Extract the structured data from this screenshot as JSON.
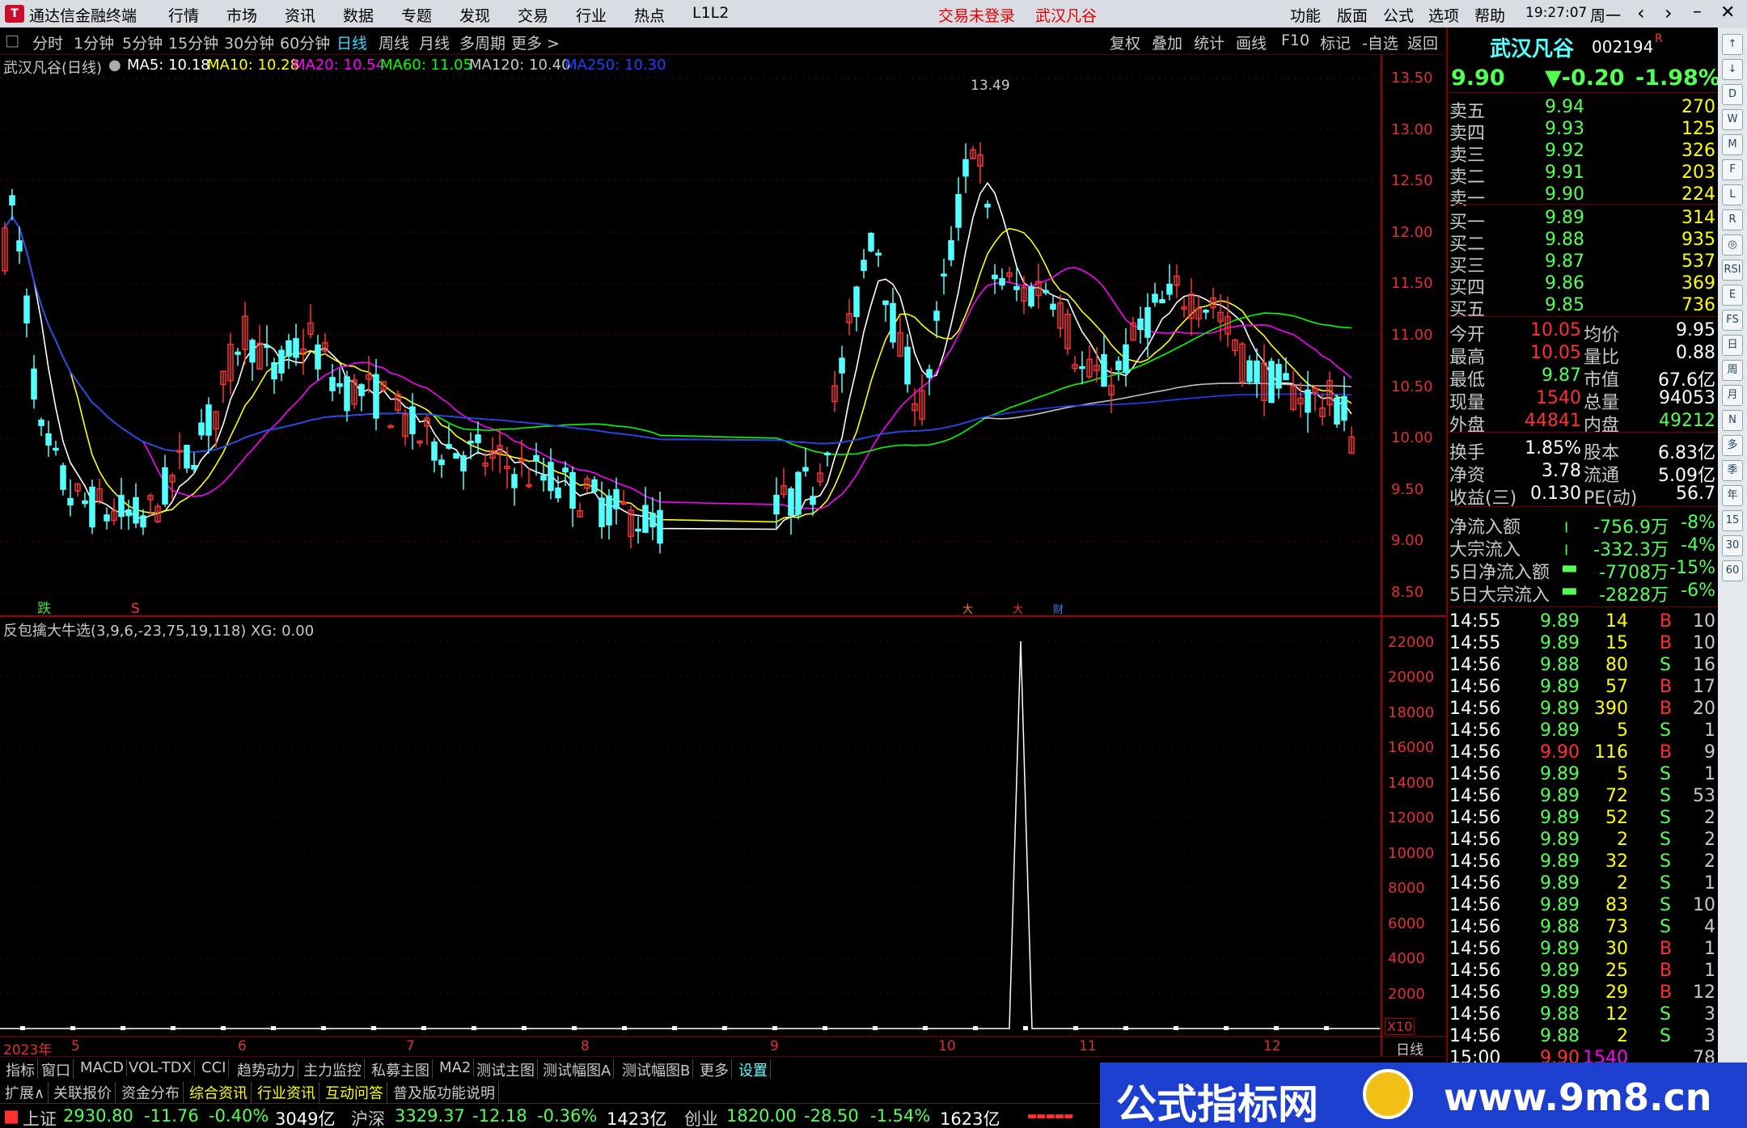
{
  "titlebar": {
    "app_title": "通达信金融终端",
    "menus": [
      "行情",
      "市场",
      "资讯",
      "数据",
      "专题",
      "发现",
      "交易",
      "行业",
      "热点",
      "L1L2"
    ],
    "status": "交易未登录",
    "stock": "武汉凡谷",
    "right_menus": [
      "功能",
      "版面",
      "公式",
      "选项",
      "帮助"
    ],
    "time": "19:27:07",
    "weekday": "周一"
  },
  "periods": {
    "items": [
      "分时",
      "1分钟",
      "5分钟",
      "15分钟",
      "30分钟",
      "60分钟",
      "日线",
      "周线",
      "月线",
      "多周期",
      "更多 >"
    ],
    "active": "日线",
    "right_items": [
      "复权",
      "叠加",
      "统计",
      "画线",
      "F10",
      "标记",
      "-自选",
      "返回"
    ]
  },
  "legend": {
    "name": "武汉凡谷(日线)",
    "ma5": "MA5: 10.18",
    "ma10": "MA10: 10.28",
    "ma20": "MA20: 10.54",
    "ma60": "MA60: 11.05",
    "ma120": "MA120: 10.40",
    "ma250": "MA250: 10.30"
  },
  "main_axis": {
    "labels": [
      "13.50",
      "13.00",
      "12.50",
      "12.00",
      "11.50",
      "11.00",
      "10.50",
      "10.00",
      "9.50",
      "9.00",
      "8.50"
    ]
  },
  "peak_label": "13.49",
  "markers": {
    "die": "跌",
    "s": "S",
    "m1": "大",
    "m2": "大",
    "m3": "财"
  },
  "indicator": {
    "title": "反包擒大牛选(3,9,6,-23,75,19,118)  XG: 0.00",
    "axis": [
      "22000",
      "20000",
      "18000",
      "16000",
      "14000",
      "12000",
      "10000",
      "8000",
      "6000",
      "4000",
      "2000"
    ],
    "unit": "X10"
  },
  "date_axis": {
    "labels": [
      "2023年",
      "5",
      "6",
      "7",
      "8",
      "9",
      "10",
      "11",
      "12"
    ],
    "period": "日线"
  },
  "quote": {
    "name": "武汉凡谷",
    "code": "002194",
    "flag": "R",
    "price": "9.90",
    "change": "▼-0.20",
    "pct": "-1.98%",
    "asks": [
      {
        "label": "卖五",
        "price": "9.94",
        "vol": "270"
      },
      {
        "label": "卖四",
        "price": "9.93",
        "vol": "125"
      },
      {
        "label": "卖三",
        "price": "9.92",
        "vol": "326"
      },
      {
        "label": "卖二",
        "price": "9.91",
        "vol": "203"
      },
      {
        "label": "卖一",
        "price": "9.90",
        "vol": "224"
      }
    ],
    "bids": [
      {
        "label": "买一",
        "price": "9.89",
        "vol": "314"
      },
      {
        "label": "买二",
        "price": "9.88",
        "vol": "935"
      },
      {
        "label": "买三",
        "price": "9.87",
        "vol": "537"
      },
      {
        "label": "买四",
        "price": "9.86",
        "vol": "369"
      },
      {
        "label": "买五",
        "price": "9.85",
        "vol": "736"
      }
    ],
    "stats": [
      {
        "k1": "今开",
        "v1": "10.05",
        "k2": "均价",
        "v2": "9.95"
      },
      {
        "k1": "最高",
        "v1": "10.05",
        "k2": "量比",
        "v2": "0.88"
      },
      {
        "k1": "最低",
        "v1": "9.87",
        "k2": "市值",
        "v2": "67.6亿"
      },
      {
        "k1": "现量",
        "v1": "1540",
        "k2": "总量",
        "v2": "94053"
      },
      {
        "k1": "外盘",
        "v1": "44841",
        "k2": "内盘",
        "v2": "49212"
      }
    ],
    "stats2": [
      {
        "k1": "换手",
        "v1": "1.85%",
        "k2": "股本",
        "v2": "6.83亿"
      },
      {
        "k1": "净资",
        "v1": "3.78",
        "k2": "流通",
        "v2": "5.09亿"
      },
      {
        "k1": "收益(三)",
        "v1": "0.130",
        "k2": "PE(动)",
        "v2": "56.7"
      }
    ],
    "flows": [
      {
        "k": "净流入额",
        "v": "-756.9万",
        "p": "-8%"
      },
      {
        "k": "大宗流入",
        "v": "-332.3万",
        "p": "-4%"
      },
      {
        "k": "5日净流入额",
        "v": "-7708万",
        "p": "-15%"
      },
      {
        "k": "5日大宗流入",
        "v": "-2828万",
        "p": "-6%"
      }
    ]
  },
  "ticks": [
    [
      "14:55",
      "9.89",
      "14",
      "B",
      "10"
    ],
    [
      "14:55",
      "9.89",
      "15",
      "B",
      "10"
    ],
    [
      "14:56",
      "9.88",
      "80",
      "S",
      "16"
    ],
    [
      "14:56",
      "9.89",
      "57",
      "B",
      "17"
    ],
    [
      "14:56",
      "9.89",
      "390",
      "B",
      "20"
    ],
    [
      "14:56",
      "9.89",
      "5",
      "S",
      "1"
    ],
    [
      "14:56",
      "9.90",
      "116",
      "B",
      "9"
    ],
    [
      "14:56",
      "9.89",
      "5",
      "S",
      "1"
    ],
    [
      "14:56",
      "9.89",
      "72",
      "S",
      "53"
    ],
    [
      "14:56",
      "9.89",
      "52",
      "S",
      "2"
    ],
    [
      "14:56",
      "9.89",
      "2",
      "S",
      "2"
    ],
    [
      "14:56",
      "9.89",
      "32",
      "S",
      "2"
    ],
    [
      "14:56",
      "9.89",
      "2",
      "S",
      "1"
    ],
    [
      "14:56",
      "9.89",
      "83",
      "S",
      "10"
    ],
    [
      "14:56",
      "9.88",
      "73",
      "S",
      "4"
    ],
    [
      "14:56",
      "9.89",
      "30",
      "B",
      "1"
    ],
    [
      "14:56",
      "9.89",
      "25",
      "B",
      "1"
    ],
    [
      "14:56",
      "9.89",
      "29",
      "B",
      "12"
    ],
    [
      "14:56",
      "9.88",
      "12",
      "S",
      "3"
    ],
    [
      "14:56",
      "9.88",
      "2",
      "S",
      "3"
    ],
    [
      "15:00",
      "9.90",
      "1540",
      "",
      "78"
    ]
  ],
  "side_tools": [
    "↑",
    "↓",
    "D",
    "W",
    "M",
    "F",
    "L",
    "R",
    "◎",
    "RSI",
    "E",
    "FS",
    "日",
    "周",
    "月",
    "N",
    "多",
    "季",
    "年",
    "15",
    "30",
    "60"
  ],
  "bottom_tabs": [
    "指标",
    "窗口",
    "MACD",
    "VOL-TDX",
    "CCI",
    "趋势动力",
    "主力监控",
    "私募主图",
    "MA2",
    "测试主图",
    "测试幅图A",
    "测试幅图B",
    "更多",
    "设置"
  ],
  "bottom_tabs2": [
    "扩展∧",
    "关联报价",
    "资金分布",
    "综合资讯",
    "行业资讯",
    "互动问答",
    "普及版功能说明"
  ],
  "status": {
    "sh_name": "上证",
    "sh_val": "2930.80",
    "sh_chg": "-11.76",
    "sh_pct": "-0.40%",
    "sh_amt": "3049亿",
    "sz_name": "沪深",
    "sz_val": "3329.37",
    "sz_chg": "-12.18",
    "sz_pct": "-0.36%",
    "sz_amt": "1423亿",
    "cy_name": "创业",
    "cy_val": "1820.00",
    "cy_chg": "-28.50",
    "cy_pct": "-1.54%",
    "cy_amt": "1623亿"
  },
  "banner": {
    "text1": "公式指标网",
    "text2": "www.9m8.cn"
  },
  "colors": {
    "up": "#ff3232",
    "down": "#54ffff",
    "ma5": "#ffffff",
    "ma10": "#ffff00",
    "ma20": "#ff00ff",
    "ma60": "#00ff00",
    "ma120": "#c0c0c0",
    "ma250": "#1f3fff"
  }
}
